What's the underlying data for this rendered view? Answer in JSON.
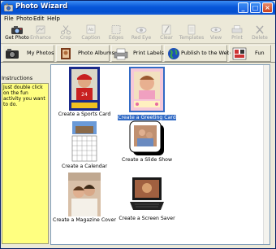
{
  "window": {
    "title": "Photo Wizard"
  },
  "menu": [
    "File",
    "Photo",
    "Edit",
    "Help"
  ],
  "toolbar": [
    {
      "label": "Get Photo",
      "icon": "camera-icon",
      "active": true
    },
    {
      "label": "Enhance",
      "icon": "enhance-icon",
      "active": false
    },
    {
      "label": "Crop",
      "icon": "crop-icon",
      "active": false
    },
    {
      "label": "Caption",
      "icon": "caption-icon",
      "active": false
    },
    {
      "label": "Edges",
      "icon": "edges-icon",
      "active": false
    },
    {
      "label": "Red Eye",
      "icon": "red-eye-icon",
      "active": false
    },
    {
      "label": "Clear",
      "icon": "clear-icon",
      "active": false
    },
    {
      "label": "Templates",
      "icon": "templates-icon",
      "active": false
    },
    {
      "label": "View",
      "icon": "view-icon",
      "active": false
    },
    {
      "label": "Print",
      "icon": "print-icon",
      "active": false
    },
    {
      "label": "Delete",
      "icon": "delete-icon",
      "active": false
    }
  ],
  "tabs": [
    {
      "label": "My Photos",
      "icon": "camera-icon"
    },
    {
      "label": "Photo Albums",
      "icon": "album-icon"
    },
    {
      "label": "Print Labels",
      "icon": "printer-icon"
    },
    {
      "label": "Publish to the Web",
      "icon": "globe-icon"
    },
    {
      "label": "Fun",
      "icon": "fun-icon"
    }
  ],
  "instructions": {
    "heading": "Instructions",
    "text": "Just double click on the fun activity you want to do."
  },
  "activities": [
    {
      "label": "Create a Sports Card",
      "selected": false
    },
    {
      "label": "Create a Greeting Card",
      "selected": true
    },
    {
      "label": "Create a Calendar",
      "selected": false
    },
    {
      "label": "Create a Slide Show",
      "selected": false
    },
    {
      "label": "Create a Magazine Cover",
      "selected": false
    },
    {
      "label": "Create a Screen Saver",
      "selected": false
    }
  ]
}
